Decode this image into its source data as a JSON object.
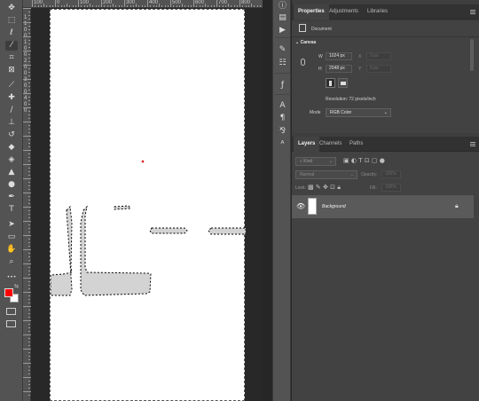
{
  "tools": [
    {
      "name": "move-tool",
      "glyph": "✥",
      "active": false
    },
    {
      "name": "marquee-tool",
      "glyph": "⬚",
      "active": false
    },
    {
      "name": "lasso-tool",
      "glyph": "ℓ",
      "active": false
    },
    {
      "name": "magic-wand-tool",
      "glyph": "⁄",
      "active": true
    },
    {
      "name": "crop-tool",
      "glyph": "⌗",
      "active": false
    },
    {
      "name": "frame-tool",
      "glyph": "⊠",
      "active": false
    },
    {
      "name": "eyedropper-tool",
      "glyph": "⟋",
      "active": false
    },
    {
      "name": "spot-healing-tool",
      "glyph": "✚",
      "active": false
    },
    {
      "name": "brush-tool",
      "glyph": "∕",
      "active": false
    },
    {
      "name": "clone-stamp-tool",
      "glyph": "⊥",
      "active": false
    },
    {
      "name": "history-brush-tool",
      "glyph": "↺",
      "active": false
    },
    {
      "name": "eraser-tool",
      "glyph": "◆",
      "active": false
    },
    {
      "name": "paint-bucket-tool",
      "glyph": "◈",
      "active": false
    },
    {
      "name": "blur-tool",
      "glyph": "▲",
      "active": false
    },
    {
      "name": "dodge-tool",
      "glyph": "●",
      "active": false
    },
    {
      "name": "pen-tool",
      "glyph": "✒",
      "active": false
    },
    {
      "name": "type-tool",
      "glyph": "T",
      "active": false
    },
    {
      "name": "path-selection-tool",
      "glyph": "➤",
      "active": false
    },
    {
      "name": "rectangle-tool",
      "glyph": "▭",
      "active": false
    },
    {
      "name": "hand-tool",
      "glyph": "✋",
      "active": false
    },
    {
      "name": "zoom-tool",
      "glyph": "⌕",
      "active": false
    },
    {
      "name": "more-tools",
      "glyph": "•••",
      "active": false
    }
  ],
  "colors": {
    "foreground": "#ff0000",
    "background": "#ffffff",
    "selection_fill": "#d3d3d3"
  },
  "ruler": {
    "top_labels": [
      "100",
      "0",
      "100",
      "200",
      "300",
      "400",
      "500",
      "600",
      "700",
      "800",
      "900",
      "1000"
    ],
    "left_labels": [
      "1",
      "1",
      "0",
      "0",
      "1",
      "0",
      "0",
      "2",
      "0",
      "0",
      "3",
      "0",
      "0",
      "4",
      "0",
      "0"
    ]
  },
  "properties_panel": {
    "tabs": [
      "Properties",
      "Adjustments",
      "Libraries"
    ],
    "active_tab": "Properties",
    "doc_label": "Document",
    "canvas_section": "Canvas",
    "width_label": "W",
    "width_value": "1024 px",
    "x_label": "X",
    "x_value": "0 px",
    "height_label": "H",
    "height_value": "2048 px",
    "y_label": "Y",
    "y_value": "0 px",
    "resolution": "Resolution: 72 pixels/inch",
    "mode_label": "Mode",
    "mode_value": "RGB Color"
  },
  "layers_panel": {
    "tabs": [
      "Layers",
      "Channels",
      "Paths"
    ],
    "active_tab": "Layers",
    "search_placeholder": "Kind",
    "blend_mode": "Normal",
    "opacity_label": "Opacity:",
    "opacity_value": "100%",
    "lock_label": "Lock:",
    "fill_label": "Fill:",
    "fill_value": "100%",
    "layers": [
      {
        "name": "Background",
        "visible": true,
        "locked": true
      }
    ]
  }
}
